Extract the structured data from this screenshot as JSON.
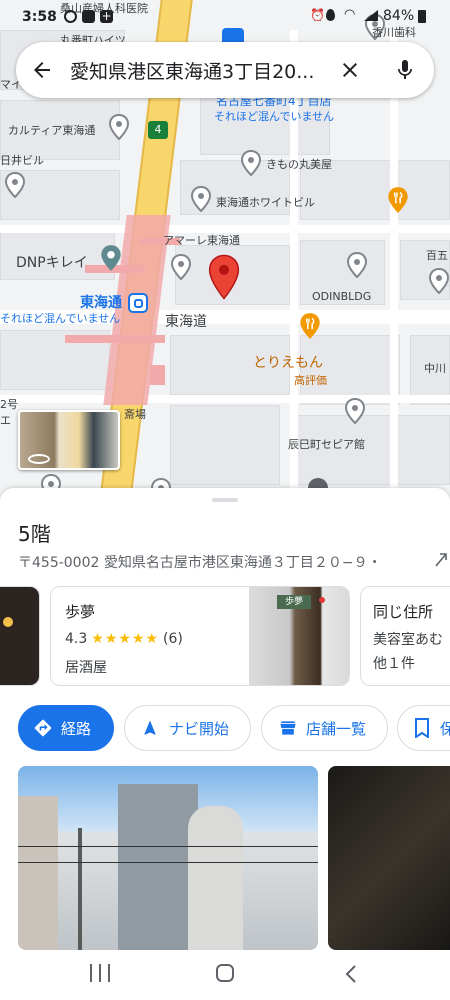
{
  "status_bar": {
    "time": "3:58",
    "battery": "84%",
    "top_map_text": "桑山産婦人科医院",
    "top_right_text": "香川歯科"
  },
  "search": {
    "query": "愛知県港区東海通3丁目20...",
    "back_icon": "arrow-left-icon",
    "clear_icon": "close-icon",
    "mic_icon": "microphone-icon"
  },
  "map": {
    "labels": {
      "karuchia": "カルティア東海通",
      "hiroyuki": "日井ビル",
      "kimono": "きもの丸美屋",
      "white_building": "東海通ホワイトビル",
      "amaare": "アマーレ東海通",
      "dnp": "DNPキレイ",
      "station": "東海通",
      "crowd_left": "それほど混んでいません",
      "crowd_top": "それほど混んでいません",
      "dept_top": "名古屋七番町4丁目店",
      "street": "東海道",
      "odin": "ODINBLDG",
      "toriemon": "とりえもん",
      "high_rating": "高評価",
      "tatsumi": "辰巳町セピア館",
      "hyakugo": "百五",
      "nakagawa": "中川",
      "kinsai": "斎場",
      "route4": "4",
      "floor2": "2号",
      "shiba": "エ",
      "top_left": "マイム",
      "top_mid": "丸番町ハイツ"
    }
  },
  "place": {
    "title": "5階",
    "address": "〒455-0002 愛知県名古屋市港区東海通３丁目２０−９・",
    "address_icon": "phone-forward-icon"
  },
  "nearby": [
    {
      "name": "歩夢",
      "rating": "4.3",
      "stars": 4.3,
      "reviews": "(6)",
      "category": "居酒屋",
      "sign_text": "歩夢"
    },
    {
      "name": "同じ住所",
      "line2": "美容室あむ",
      "line3": "他１件"
    }
  ],
  "actions": {
    "route": "経路",
    "navigate": "ナビ開始",
    "shop_list": "店舗一覧",
    "save": "保"
  },
  "colors": {
    "accent": "#1a73e8",
    "pin_red": "#ea4335",
    "station_pink": "#f2a9a9",
    "orange": "#f29900",
    "star": "#fbbc04"
  }
}
